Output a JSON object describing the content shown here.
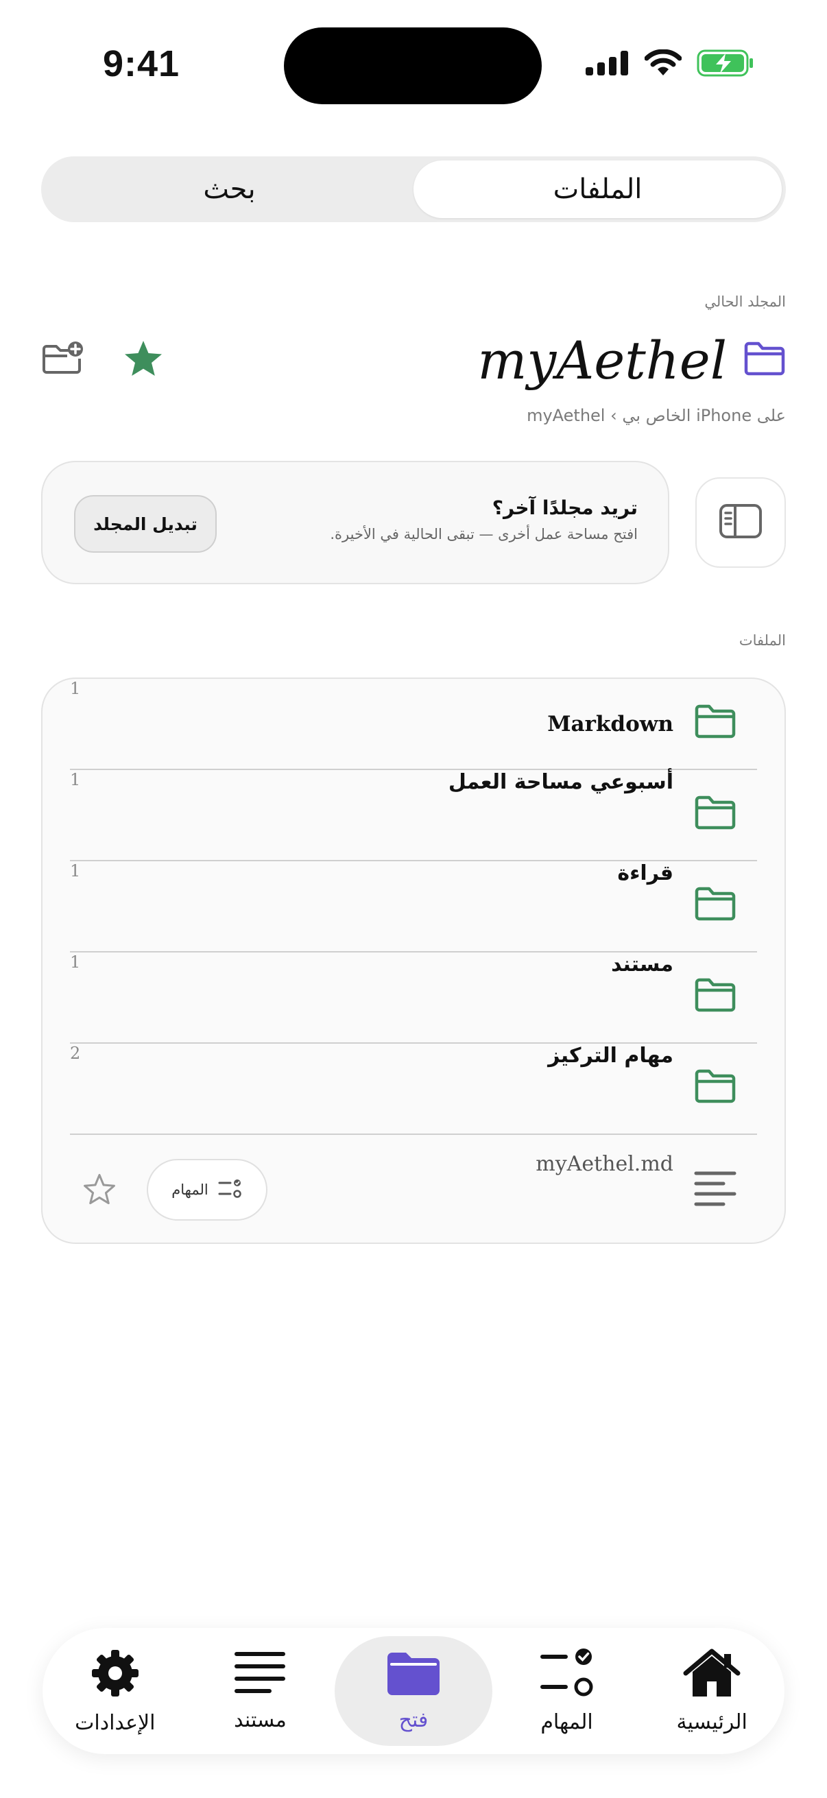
{
  "status_bar": {
    "time": "9:41"
  },
  "segmented": {
    "files": "الملفات",
    "search": "بحث"
  },
  "current_folder": {
    "caption": "المجلد الحالي",
    "title": "myAethel",
    "path": "على iPhone الخاص بي › myAethel",
    "favorite": true,
    "accent_color": "#6451cf",
    "star_color": "#3e8e5c"
  },
  "switch_card": {
    "title": "تريد مجلدًا آخر؟",
    "subtitle": "افتح مساحة عمل أخرى — تبقى الحالية في الأخيرة.",
    "button": "تبديل المجلد"
  },
  "files": {
    "caption": "الملفات",
    "folder_color": "#3e8e5c",
    "items": [
      {
        "name": "Markdown",
        "count": "1"
      },
      {
        "name": "أسبوعي مساحة العمل",
        "count": "1"
      },
      {
        "name": "قراءة",
        "count": "1"
      },
      {
        "name": "مستند",
        "count": "1"
      },
      {
        "name": "مهام التركيز",
        "count": "2"
      }
    ],
    "footer": {
      "file_name": "myAethel.md",
      "tasks_chip": "المهام"
    }
  },
  "tab_bar": {
    "active_color": "#6451cf",
    "tabs": [
      {
        "label": "الإعدادات",
        "icon": "gear-icon"
      },
      {
        "label": "مستند",
        "icon": "document-lines-icon"
      },
      {
        "label": "فتح",
        "icon": "folder-icon",
        "active": true
      },
      {
        "label": "المهام",
        "icon": "tasks-icon"
      },
      {
        "label": "الرئيسية",
        "icon": "home-icon"
      }
    ]
  }
}
